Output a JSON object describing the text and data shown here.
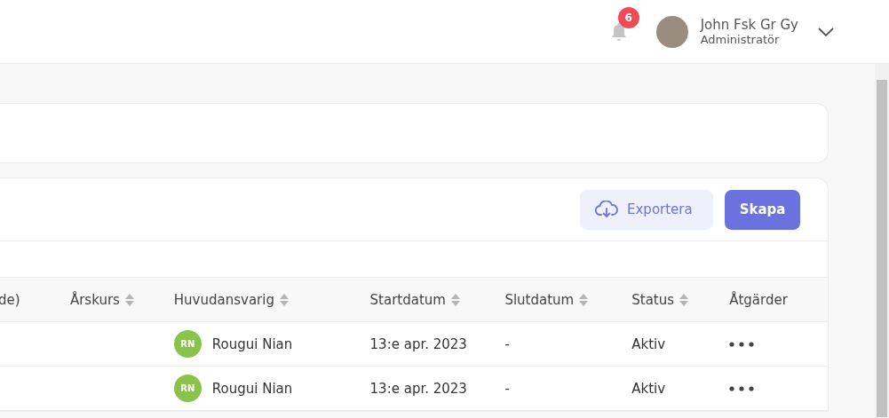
{
  "header": {
    "notifications": {
      "count": "6"
    },
    "user": {
      "name": "John Fsk Gr Gy",
      "role": "Administratör"
    }
  },
  "toolbar": {
    "buttons": [
      {
        "label": "Exportera",
        "kind": "export"
      },
      {
        "label": "Skapa",
        "kind": "primary"
      }
    ]
  },
  "table": {
    "columns": [
      {
        "label": "de)",
        "sortable": false
      },
      {
        "label": "Årskurs",
        "sortable": true
      },
      {
        "label": "Huvudansvarig",
        "sortable": true
      },
      {
        "label": "Startdatum",
        "sortable": true
      },
      {
        "label": "Slutdatum",
        "sortable": true
      },
      {
        "label": "Status",
        "sortable": true
      },
      {
        "label": "Åtgärder",
        "sortable": false
      }
    ],
    "rows": [
      {
        "owner": {
          "initials": "RN",
          "name": "Rougui Nian"
        },
        "start": "13:e apr. 2023",
        "end": "-",
        "status": "Aktiv"
      },
      {
        "owner": {
          "initials": "RN",
          "name": "Rougui Nian"
        },
        "start": "13:e apr. 2023",
        "end": "-",
        "status": "Aktiv"
      }
    ]
  }
}
